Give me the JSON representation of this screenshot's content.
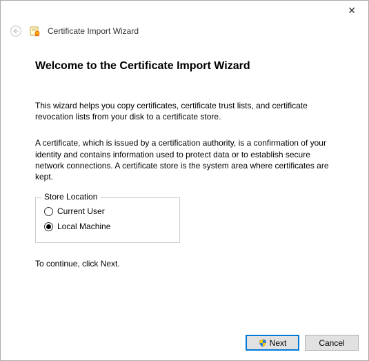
{
  "header": {
    "window_title": "Certificate Import Wizard"
  },
  "main": {
    "heading": "Welcome to the Certificate Import Wizard",
    "intro": "This wizard helps you copy certificates, certificate trust lists, and certificate revocation lists from your disk to a certificate store.",
    "description": "A certificate, which is issued by a certification authority, is a confirmation of your identity and contains information used to protect data or to establish secure network connections. A certificate store is the system area where certificates are kept.",
    "continue_hint": "To continue, click Next."
  },
  "store_location": {
    "legend": "Store Location",
    "options": {
      "current_user": "Current User",
      "local_machine": "Local Machine"
    },
    "selected": "local_machine"
  },
  "buttons": {
    "next": "Next",
    "cancel": "Cancel"
  },
  "icons": {
    "back": "back-arrow-icon",
    "certificate": "certificate-icon",
    "close": "close-icon",
    "shield": "uac-shield-icon"
  }
}
